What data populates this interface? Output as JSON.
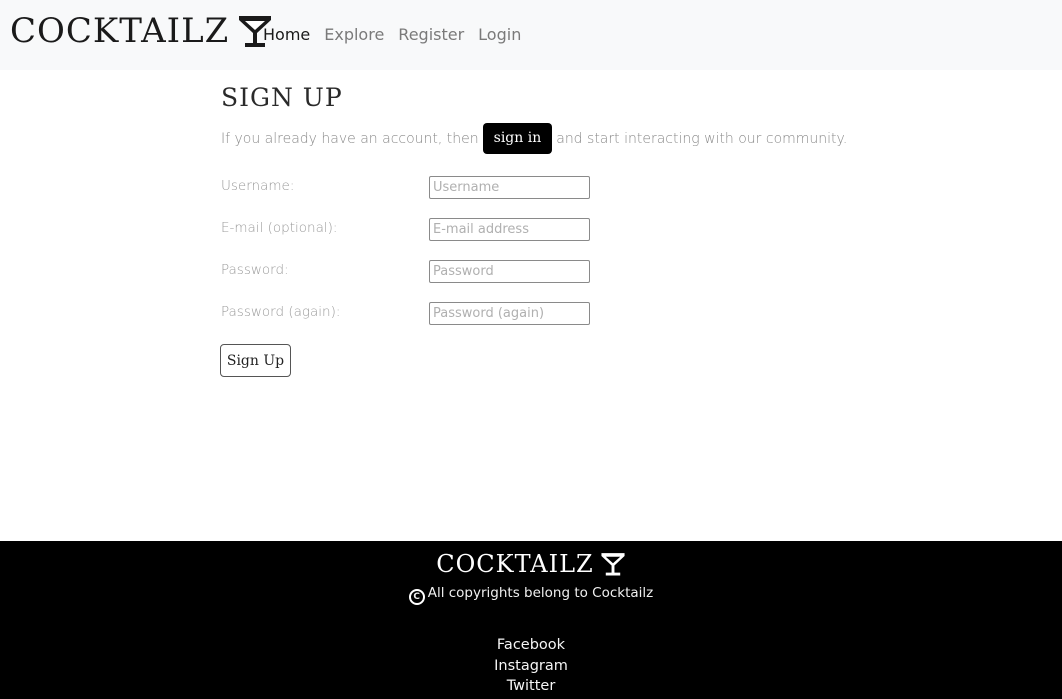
{
  "navbar": {
    "brand": "COCKTAILZ",
    "brand_icon": "cocktail-glass-icon",
    "links": [
      {
        "label": "Home",
        "active": true
      },
      {
        "label": "Explore",
        "active": false
      },
      {
        "label": "Register",
        "active": false
      },
      {
        "label": "Login",
        "active": false
      }
    ]
  },
  "main": {
    "title": "SIGN UP",
    "lead_before": "If you already have an account, then",
    "signin_label": "sign in",
    "lead_after": "and start interacting with our community.",
    "form": {
      "fields": [
        {
          "label": "Username:",
          "placeholder": "Username",
          "value": ""
        },
        {
          "label": "E-mail (optional):",
          "placeholder": "E-mail address",
          "value": ""
        },
        {
          "label": "Password:",
          "placeholder": "Password",
          "value": ""
        },
        {
          "label": "Password (again):",
          "placeholder": "Password (again)",
          "value": ""
        }
      ],
      "submit_label": "Sign Up"
    }
  },
  "footer": {
    "brand": "COCKTAILZ",
    "brand_icon": "cocktail-glass-icon",
    "copyright_icon": "copyright-icon",
    "copyright": "All copyrights belong to Cocktailz",
    "social": [
      "Facebook",
      "Instagram",
      "Twitter"
    ]
  },
  "colors": {
    "navbar_bg": "#f8f9fa",
    "footer_bg": "#000000",
    "accent": "#000000"
  }
}
